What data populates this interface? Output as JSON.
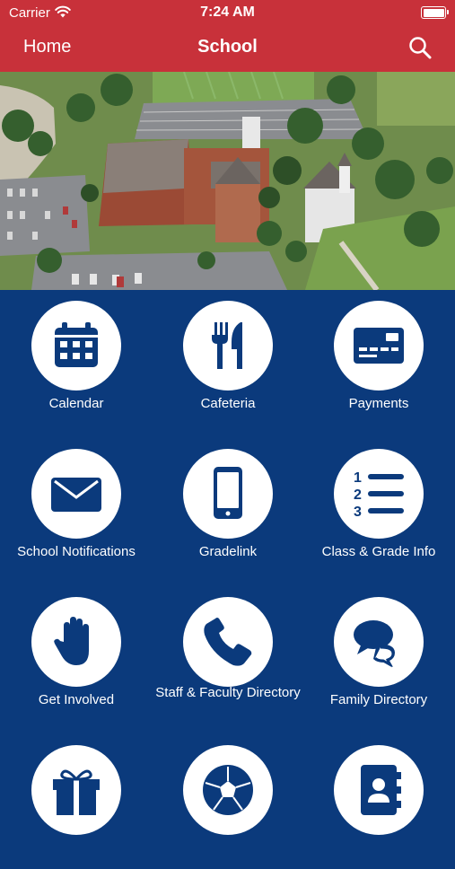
{
  "status_bar": {
    "carrier": "Carrier",
    "time": "7:24 AM"
  },
  "nav": {
    "back_label": "Home",
    "title": "School"
  },
  "carousel": {
    "pages": 6,
    "active_index": 0
  },
  "tiles": [
    {
      "label": "Calendar",
      "icon": "calendar-icon"
    },
    {
      "label": "Cafeteria",
      "icon": "fork-knife-icon"
    },
    {
      "label": "Payments",
      "icon": "payment-card-icon"
    },
    {
      "label": "School Notifications",
      "icon": "envelope-icon"
    },
    {
      "label": "Gradelink",
      "icon": "smartphone-icon"
    },
    {
      "label": "Class & Grade Info",
      "icon": "numbered-list-icon"
    },
    {
      "label": "Get Involved",
      "icon": "raised-hand-icon"
    },
    {
      "label": "Staff & Faculty Directory",
      "icon": "phone-handset-icon"
    },
    {
      "label": "Family Directory",
      "icon": "chat-bubbles-icon"
    },
    {
      "label": "",
      "icon": "gift-icon"
    },
    {
      "label": "",
      "icon": "soccer-ball-icon"
    },
    {
      "label": "",
      "icon": "contact-book-icon"
    }
  ],
  "colors": {
    "header_red": "#c8313a",
    "background_blue": "#0b3a7c",
    "icon_blue": "#0b3a7c"
  }
}
